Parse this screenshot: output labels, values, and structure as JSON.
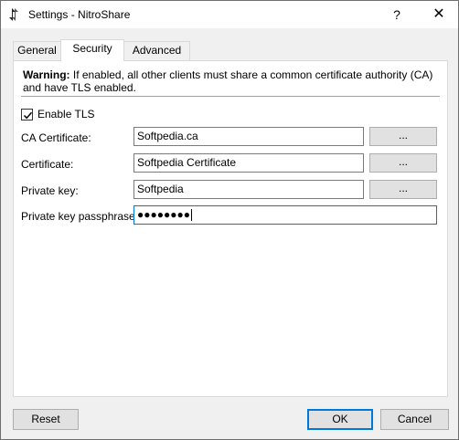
{
  "window": {
    "title": "Settings - NitroShare",
    "help_label": "?",
    "close_label": "✕"
  },
  "tabs": [
    {
      "label": "General",
      "active": false
    },
    {
      "label": "Security",
      "active": true
    },
    {
      "label": "Advanced",
      "active": false
    }
  ],
  "security": {
    "warning_prefix": "Warning:",
    "warning_text": " If enabled, all other clients must share a common certificate authority (CA) and have TLS enabled.",
    "enable_tls_label": "Enable TLS",
    "enable_tls_checked": true,
    "fields": [
      {
        "label": "CA Certificate:",
        "value": "Softpedia.ca",
        "browse": "..."
      },
      {
        "label": "Certificate:",
        "value": "Softpedia Certificate",
        "browse": "..."
      },
      {
        "label": "Private key:",
        "value": "Softpedia",
        "browse": "..."
      },
      {
        "label": "Private key passphrase:",
        "value": "●●●●●●●●"
      }
    ]
  },
  "footer": {
    "reset_label": "Reset",
    "ok_label": "OK",
    "cancel_label": "Cancel"
  },
  "colors": {
    "focus_accent": "#0078d7",
    "button_face": "#e1e1e1",
    "window_bg": "#f0f0f0"
  }
}
